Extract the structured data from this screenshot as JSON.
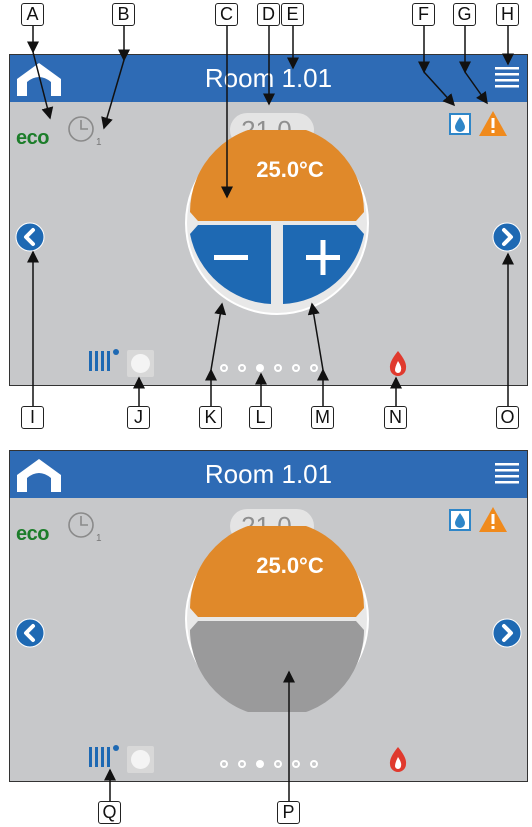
{
  "callouts": {
    "A": "A",
    "B": "B",
    "C": "C",
    "D": "D",
    "E": "E",
    "F": "F",
    "G": "G",
    "H": "H",
    "I": "I",
    "J": "J",
    "K": "K",
    "L": "L",
    "M": "M",
    "N": "N",
    "O": "O",
    "P": "P",
    "Q": "Q"
  },
  "screens": [
    {
      "title": "Room 1.01",
      "eco_label": "eco",
      "schedule_number": "1",
      "setpoint_value": "21.0",
      "setpoint_unit": "°C",
      "dial_value": "25.0°C",
      "dial_mode": "adjust",
      "page_dots": 6,
      "active_dot": 3
    },
    {
      "title": "Room 1.01",
      "eco_label": "eco",
      "schedule_number": "1",
      "setpoint_value": "21.0",
      "setpoint_unit": "°C",
      "dial_value": "25.0°C",
      "dial_mode": "display",
      "page_dots": 6,
      "active_dot": 3
    }
  ],
  "icons": {
    "home": "home-icon",
    "menu": "hamburger-menu-icon",
    "clock": "clock-icon",
    "humidity": "water-drop-icon",
    "warning": "warning-icon",
    "prev": "chevron-left-icon",
    "next": "chevron-right-icon",
    "radiator": "radiator-icon",
    "flame": "flame-icon",
    "minus": "minus-icon",
    "plus": "plus-icon"
  },
  "colors": {
    "header_blue": "#2e6bb5",
    "panel_grey": "#c7c8ca",
    "dial_orange": "#e0892a",
    "control_blue": "#1e69b3",
    "eco_green": "#1c7d2a",
    "warning_orange": "#f08a1c",
    "flame_red": "#e03a2e"
  }
}
